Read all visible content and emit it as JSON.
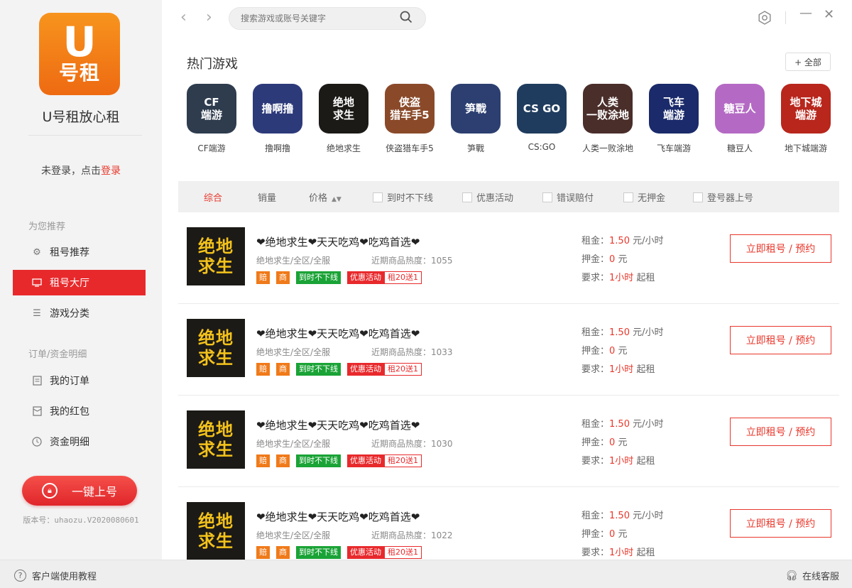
{
  "app": {
    "logo_letter": "U",
    "logo_text": "号租",
    "brand_name": "U号租放心租",
    "accent_color": "#e8292c",
    "logo_color": "#f28a18"
  },
  "sidebar": {
    "login_prefix": "未登录，点击",
    "login_link": "登录",
    "section_recommend": "为您推荐",
    "section_orders": "订单/资金明细",
    "items": [
      {
        "label": "租号推荐",
        "icon": "gear-icon",
        "active": false
      },
      {
        "label": "租号大厅",
        "icon": "monitor-icon",
        "active": true
      },
      {
        "label": "游戏分类",
        "icon": "list-icon",
        "active": false
      },
      {
        "label": "我的订单",
        "icon": "order-icon",
        "active": false
      },
      {
        "label": "我的红包",
        "icon": "redpacket-icon",
        "active": false
      },
      {
        "label": "资金明细",
        "icon": "clock-icon",
        "active": false
      }
    ],
    "one_key_label": "一键上号",
    "version": "版本号：uhaozu.V2020080601"
  },
  "topbar": {
    "search_placeholder": "搜索游戏或账号关键字",
    "back_icon": "chevron-left-icon",
    "forward_icon": "chevron-right-icon"
  },
  "hot_games": {
    "title": "热门游戏",
    "all_label": "+ 全部",
    "games": [
      {
        "name": "CF端游",
        "tile_text": "CF\n端游",
        "color": "#2e3c4e"
      },
      {
        "name": "撸啊撸",
        "tile_text": "撸啊撸",
        "color": "#2d3a7a"
      },
      {
        "name": "绝地求生",
        "tile_text": "绝地\n求生",
        "color": "#1c1a17"
      },
      {
        "name": "侠盗猎车手5",
        "tile_text": "侠盗\n猎车手5",
        "color": "#8a4a2a"
      },
      {
        "name": "笋戰",
        "tile_text": "笋戰",
        "color": "#2c3f70"
      },
      {
        "name": "CS:GO",
        "tile_text": "CS GO",
        "color": "#1f3c5e"
      },
      {
        "name": "人类一败涂地",
        "tile_text": "人类\n一败涂地",
        "color": "#4a2e2a"
      },
      {
        "name": "飞车端游",
        "tile_text": "飞车\n端游",
        "color": "#1a2a6a"
      },
      {
        "name": "糖豆人",
        "tile_text": "糖豆人",
        "color": "#b46ac4"
      },
      {
        "name": "地下城端游",
        "tile_text": "地下城\n端游",
        "color": "#b8261c"
      }
    ]
  },
  "filters": {
    "sort_default": "综合",
    "sort_sales": "销量",
    "sort_price": "价格",
    "options": [
      "到时不下线",
      "优惠活动",
      "错误赔付",
      "无押金",
      "登号器上号"
    ]
  },
  "listings": [
    {
      "thumb_text": "绝地求生",
      "title": "❤绝地求生❤天天吃鸡❤吃鸡首选❤",
      "subtitle": "绝地求生/全区/全服",
      "heat_label": "近期商品热度：",
      "heat": "1055",
      "tags": [
        "赔",
        "商",
        "到时不下线",
        "优惠活动",
        "租20送1"
      ],
      "rent_label": "租金：",
      "rent_value": "1.50",
      "rent_unit": "元/小时",
      "deposit_label": "押金：",
      "deposit_value": "0",
      "deposit_unit": "元",
      "req_label": "要求：",
      "req_value": "1小时",
      "req_unit": "起租",
      "button": "立即租号 / 预约"
    },
    {
      "thumb_text": "绝地求生",
      "title": "❤绝地求生❤天天吃鸡❤吃鸡首选❤",
      "subtitle": "绝地求生/全区/全服",
      "heat_label": "近期商品热度：",
      "heat": "1033",
      "tags": [
        "赔",
        "商",
        "到时不下线",
        "优惠活动",
        "租20送1"
      ],
      "rent_label": "租金：",
      "rent_value": "1.50",
      "rent_unit": "元/小时",
      "deposit_label": "押金：",
      "deposit_value": "0",
      "deposit_unit": "元",
      "req_label": "要求：",
      "req_value": "1小时",
      "req_unit": "起租",
      "button": "立即租号 / 预约"
    },
    {
      "thumb_text": "绝地求生",
      "title": "❤绝地求生❤天天吃鸡❤吃鸡首选❤",
      "subtitle": "绝地求生/全区/全服",
      "heat_label": "近期商品热度：",
      "heat": "1030",
      "tags": [
        "赔",
        "商",
        "到时不下线",
        "优惠活动",
        "租20送1"
      ],
      "rent_label": "租金：",
      "rent_value": "1.50",
      "rent_unit": "元/小时",
      "deposit_label": "押金：",
      "deposit_value": "0",
      "deposit_unit": "元",
      "req_label": "要求：",
      "req_value": "1小时",
      "req_unit": "起租",
      "button": "立即租号 / 预约"
    },
    {
      "thumb_text": "绝地求生",
      "title": "❤绝地求生❤天天吃鸡❤吃鸡首选❤",
      "subtitle": "绝地求生/全区/全服",
      "heat_label": "近期商品热度：",
      "heat": "1022",
      "tags": [
        "赔",
        "商",
        "到时不下线",
        "优惠活动",
        "租20送1"
      ],
      "rent_label": "租金：",
      "rent_value": "1.50",
      "rent_unit": "元/小时",
      "deposit_label": "押金：",
      "deposit_value": "0",
      "deposit_unit": "元",
      "req_label": "要求：",
      "req_value": "1小时",
      "req_unit": "起租",
      "button": "立即租号 / 预约"
    }
  ],
  "bottombar": {
    "tutorial": "客户端使用教程",
    "service": "在线客服"
  }
}
